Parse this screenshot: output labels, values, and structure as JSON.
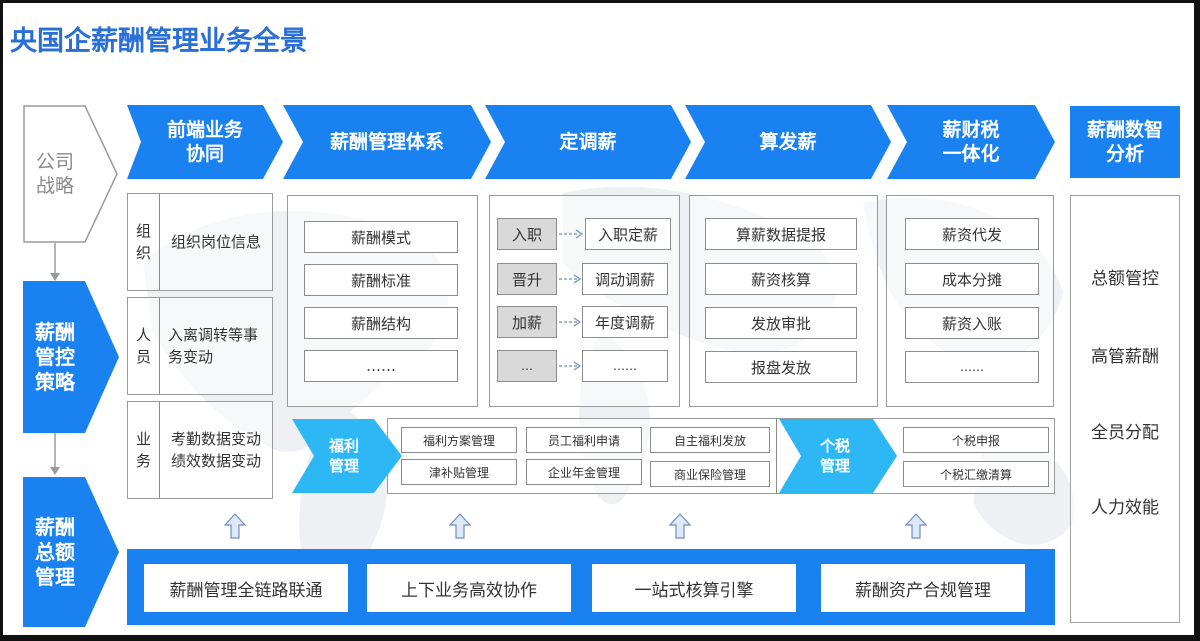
{
  "title": "央国企薪酬管理业务全景",
  "colors": {
    "primary_blue": "#1a82f0",
    "light_blue": "#2db7f5",
    "title_blue": "#2a6fd6",
    "gray_box": "#d9d9d9"
  },
  "left_column": {
    "strategy": "公司\n战略",
    "control": "薪酬\n管控\n策略",
    "total": "薪酬\n总额\n管理"
  },
  "stages": [
    {
      "label": "前端业务\n协同"
    },
    {
      "label": "薪酬管理体系"
    },
    {
      "label": "定调薪"
    },
    {
      "label": "算发薪"
    },
    {
      "label": "薪财税\n一体化"
    }
  ],
  "frontend": {
    "rows": [
      {
        "category": "组\n织",
        "content": "组织岗位信息"
      },
      {
        "category": "人\n员",
        "content": "入离调转等事\n务变动"
      },
      {
        "category": "业\n务",
        "content": "考勤数据变动\n绩效数据变动"
      }
    ]
  },
  "system": {
    "items": [
      "薪酬模式",
      "薪酬标准",
      "薪酬结构",
      "……"
    ]
  },
  "adjust": {
    "rows": [
      {
        "trigger": "入职",
        "result": "入职定薪"
      },
      {
        "trigger": "晋升",
        "result": "调动调薪"
      },
      {
        "trigger": "加薪",
        "result": "年度调薪"
      },
      {
        "trigger": "…",
        "result": "……"
      }
    ]
  },
  "payroll": {
    "items": [
      "算薪数据提报",
      "薪资核算",
      "发放审批",
      "报盘发放"
    ]
  },
  "finance": {
    "items": [
      "薪资代发",
      "成本分摊",
      "薪资入账",
      "……"
    ]
  },
  "welfare": {
    "label": "福利\n管理",
    "items": [
      "福利方案管理",
      "员工福利申请",
      "自主福利发放",
      "津补贴管理",
      "企业年金管理",
      "商业保险管理"
    ]
  },
  "tax": {
    "label": "个税\n管理",
    "items": [
      "个税申报",
      "个税汇缴清算"
    ]
  },
  "analysis": {
    "header": "薪酬数智\n分析",
    "items": [
      "总额管控",
      "高管薪酬",
      "全员分配",
      "人力效能"
    ]
  },
  "foundation": {
    "items": [
      "薪酬管理全链路联通",
      "上下业务高效协作",
      "一站式核算引擎",
      "薪酬资产合规管理"
    ]
  }
}
